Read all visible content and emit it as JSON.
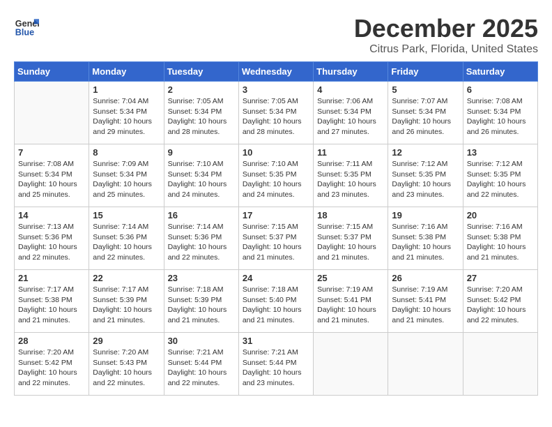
{
  "logo": {
    "text_general": "General",
    "text_blue": "Blue"
  },
  "header": {
    "title": "December 2025",
    "subtitle": "Citrus Park, Florida, United States"
  },
  "days_of_week": [
    "Sunday",
    "Monday",
    "Tuesday",
    "Wednesday",
    "Thursday",
    "Friday",
    "Saturday"
  ],
  "weeks": [
    [
      {
        "day": "",
        "empty": true
      },
      {
        "day": "1",
        "sunrise": "7:04 AM",
        "sunset": "5:34 PM",
        "daylight": "10 hours and 29 minutes."
      },
      {
        "day": "2",
        "sunrise": "7:05 AM",
        "sunset": "5:34 PM",
        "daylight": "10 hours and 28 minutes."
      },
      {
        "day": "3",
        "sunrise": "7:05 AM",
        "sunset": "5:34 PM",
        "daylight": "10 hours and 28 minutes."
      },
      {
        "day": "4",
        "sunrise": "7:06 AM",
        "sunset": "5:34 PM",
        "daylight": "10 hours and 27 minutes."
      },
      {
        "day": "5",
        "sunrise": "7:07 AM",
        "sunset": "5:34 PM",
        "daylight": "10 hours and 26 minutes."
      },
      {
        "day": "6",
        "sunrise": "7:08 AM",
        "sunset": "5:34 PM",
        "daylight": "10 hours and 26 minutes."
      }
    ],
    [
      {
        "day": "7",
        "sunrise": "7:08 AM",
        "sunset": "5:34 PM",
        "daylight": "10 hours and 25 minutes."
      },
      {
        "day": "8",
        "sunrise": "7:09 AM",
        "sunset": "5:34 PM",
        "daylight": "10 hours and 25 minutes."
      },
      {
        "day": "9",
        "sunrise": "7:10 AM",
        "sunset": "5:34 PM",
        "daylight": "10 hours and 24 minutes."
      },
      {
        "day": "10",
        "sunrise": "7:10 AM",
        "sunset": "5:35 PM",
        "daylight": "10 hours and 24 minutes."
      },
      {
        "day": "11",
        "sunrise": "7:11 AM",
        "sunset": "5:35 PM",
        "daylight": "10 hours and 23 minutes."
      },
      {
        "day": "12",
        "sunrise": "7:12 AM",
        "sunset": "5:35 PM",
        "daylight": "10 hours and 23 minutes."
      },
      {
        "day": "13",
        "sunrise": "7:12 AM",
        "sunset": "5:35 PM",
        "daylight": "10 hours and 22 minutes."
      }
    ],
    [
      {
        "day": "14",
        "sunrise": "7:13 AM",
        "sunset": "5:36 PM",
        "daylight": "10 hours and 22 minutes."
      },
      {
        "day": "15",
        "sunrise": "7:14 AM",
        "sunset": "5:36 PM",
        "daylight": "10 hours and 22 minutes."
      },
      {
        "day": "16",
        "sunrise": "7:14 AM",
        "sunset": "5:36 PM",
        "daylight": "10 hours and 22 minutes."
      },
      {
        "day": "17",
        "sunrise": "7:15 AM",
        "sunset": "5:37 PM",
        "daylight": "10 hours and 21 minutes."
      },
      {
        "day": "18",
        "sunrise": "7:15 AM",
        "sunset": "5:37 PM",
        "daylight": "10 hours and 21 minutes."
      },
      {
        "day": "19",
        "sunrise": "7:16 AM",
        "sunset": "5:38 PM",
        "daylight": "10 hours and 21 minutes."
      },
      {
        "day": "20",
        "sunrise": "7:16 AM",
        "sunset": "5:38 PM",
        "daylight": "10 hours and 21 minutes."
      }
    ],
    [
      {
        "day": "21",
        "sunrise": "7:17 AM",
        "sunset": "5:38 PM",
        "daylight": "10 hours and 21 minutes."
      },
      {
        "day": "22",
        "sunrise": "7:17 AM",
        "sunset": "5:39 PM",
        "daylight": "10 hours and 21 minutes."
      },
      {
        "day": "23",
        "sunrise": "7:18 AM",
        "sunset": "5:39 PM",
        "daylight": "10 hours and 21 minutes."
      },
      {
        "day": "24",
        "sunrise": "7:18 AM",
        "sunset": "5:40 PM",
        "daylight": "10 hours and 21 minutes."
      },
      {
        "day": "25",
        "sunrise": "7:19 AM",
        "sunset": "5:41 PM",
        "daylight": "10 hours and 21 minutes."
      },
      {
        "day": "26",
        "sunrise": "7:19 AM",
        "sunset": "5:41 PM",
        "daylight": "10 hours and 21 minutes."
      },
      {
        "day": "27",
        "sunrise": "7:20 AM",
        "sunset": "5:42 PM",
        "daylight": "10 hours and 22 minutes."
      }
    ],
    [
      {
        "day": "28",
        "sunrise": "7:20 AM",
        "sunset": "5:42 PM",
        "daylight": "10 hours and 22 minutes."
      },
      {
        "day": "29",
        "sunrise": "7:20 AM",
        "sunset": "5:43 PM",
        "daylight": "10 hours and 22 minutes."
      },
      {
        "day": "30",
        "sunrise": "7:21 AM",
        "sunset": "5:44 PM",
        "daylight": "10 hours and 22 minutes."
      },
      {
        "day": "31",
        "sunrise": "7:21 AM",
        "sunset": "5:44 PM",
        "daylight": "10 hours and 23 minutes."
      },
      {
        "day": "",
        "empty": true
      },
      {
        "day": "",
        "empty": true
      },
      {
        "day": "",
        "empty": true
      }
    ]
  ]
}
